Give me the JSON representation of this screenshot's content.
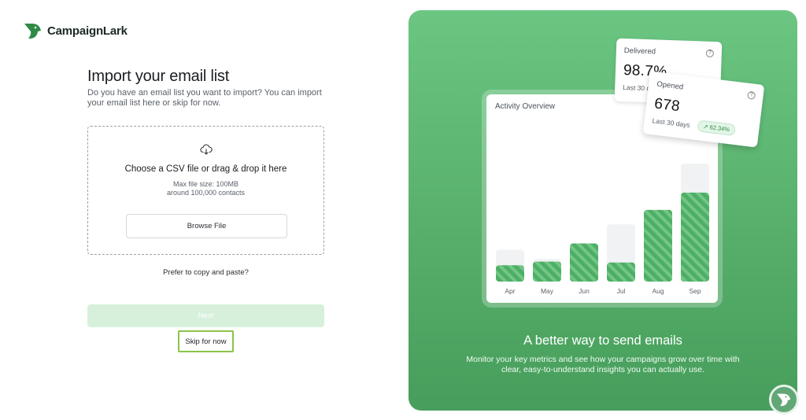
{
  "brand": {
    "name": "CampaignLark"
  },
  "import": {
    "title": "Import your email list",
    "subtitle": "Do you have an email list you want to import? You can import your email list here or skip for now.",
    "dropzone_title": "Choose a CSV file or drag & drop it here",
    "max_size": "Max file size: 100MB",
    "max_contacts": "around 100,000 contacts",
    "browse_label": "Browse File",
    "paste_link": "Prefer to copy and paste?",
    "next_label": "Next",
    "skip_label": "Skip for now"
  },
  "promo": {
    "heading": "A better way to send emails",
    "description": "Monitor your key metrics and see how your campaigns grow over time with clear, easy-to-understand insights you can actually use.",
    "chart_title": "Activity Overview",
    "delivered": {
      "label": "Delivered",
      "value": "98.7%",
      "sub": "Last 30 days"
    },
    "opened": {
      "label": "Opened",
      "value": "678",
      "sub": "Last 30 days",
      "change": "↗ 62.34%"
    }
  },
  "chart_data": {
    "type": "bar",
    "title": "Activity Overview",
    "categories": [
      "Apr",
      "May",
      "Jun",
      "Jul",
      "Aug",
      "Sep"
    ],
    "series": [
      {
        "values": [
          18,
          22,
          42,
          21,
          79,
          98
        ]
      }
    ],
    "background_values": [
      35,
      25,
      42,
      63,
      79,
      130
    ],
    "ylim": [
      0,
      130
    ]
  },
  "colors": {
    "accent": "#5cb872",
    "bar_green": "#4caf65",
    "bar_bg": "#f1f2f3"
  }
}
